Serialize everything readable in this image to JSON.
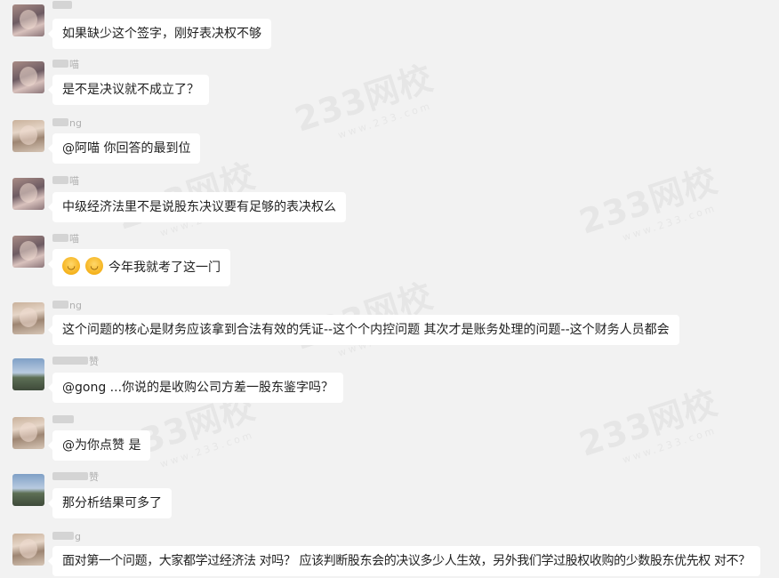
{
  "messages": [
    {
      "sender_suffix": "",
      "text": "如果缺少这个签字，刚好表决权不够"
    },
    {
      "sender_suffix": "喵",
      "text": "是不是决议就不成立了？"
    },
    {
      "sender_suffix": "ng",
      "text": "@阿喵 你回答的最到位"
    },
    {
      "sender_suffix": "喵",
      "text": "中级经济法里不是说股东决议要有足够的表决权么"
    },
    {
      "sender_suffix": "喵",
      "text": "今年我就考了这一门",
      "emoji_names": [
        "laugh-cry-emoji",
        "laugh-cry-emoji"
      ]
    },
    {
      "sender_suffix": "ng",
      "text": "这个问题的核心是财务应该拿到合法有效的凭证--这个个内控问题 其次才是账务处理的问题--这个财务人员都会"
    },
    {
      "sender_suffix": "赞",
      "text": "@gong ...你说的是收购公司方差一股东鉴字吗？"
    },
    {
      "sender_suffix": "",
      "text": "@为你点赞 是"
    },
    {
      "sender_suffix": "赞",
      "text": "那分析结果可多了"
    },
    {
      "sender_suffix": "g",
      "text": "面对第一个问题，大家都学过经济法 对吗？ 应该判断股东会的决议多少人生效，另外我们学过股权收购的少数股东优先权 对不？"
    }
  ],
  "watermark": {
    "text": "233网校",
    "sub": "www.233.com"
  }
}
